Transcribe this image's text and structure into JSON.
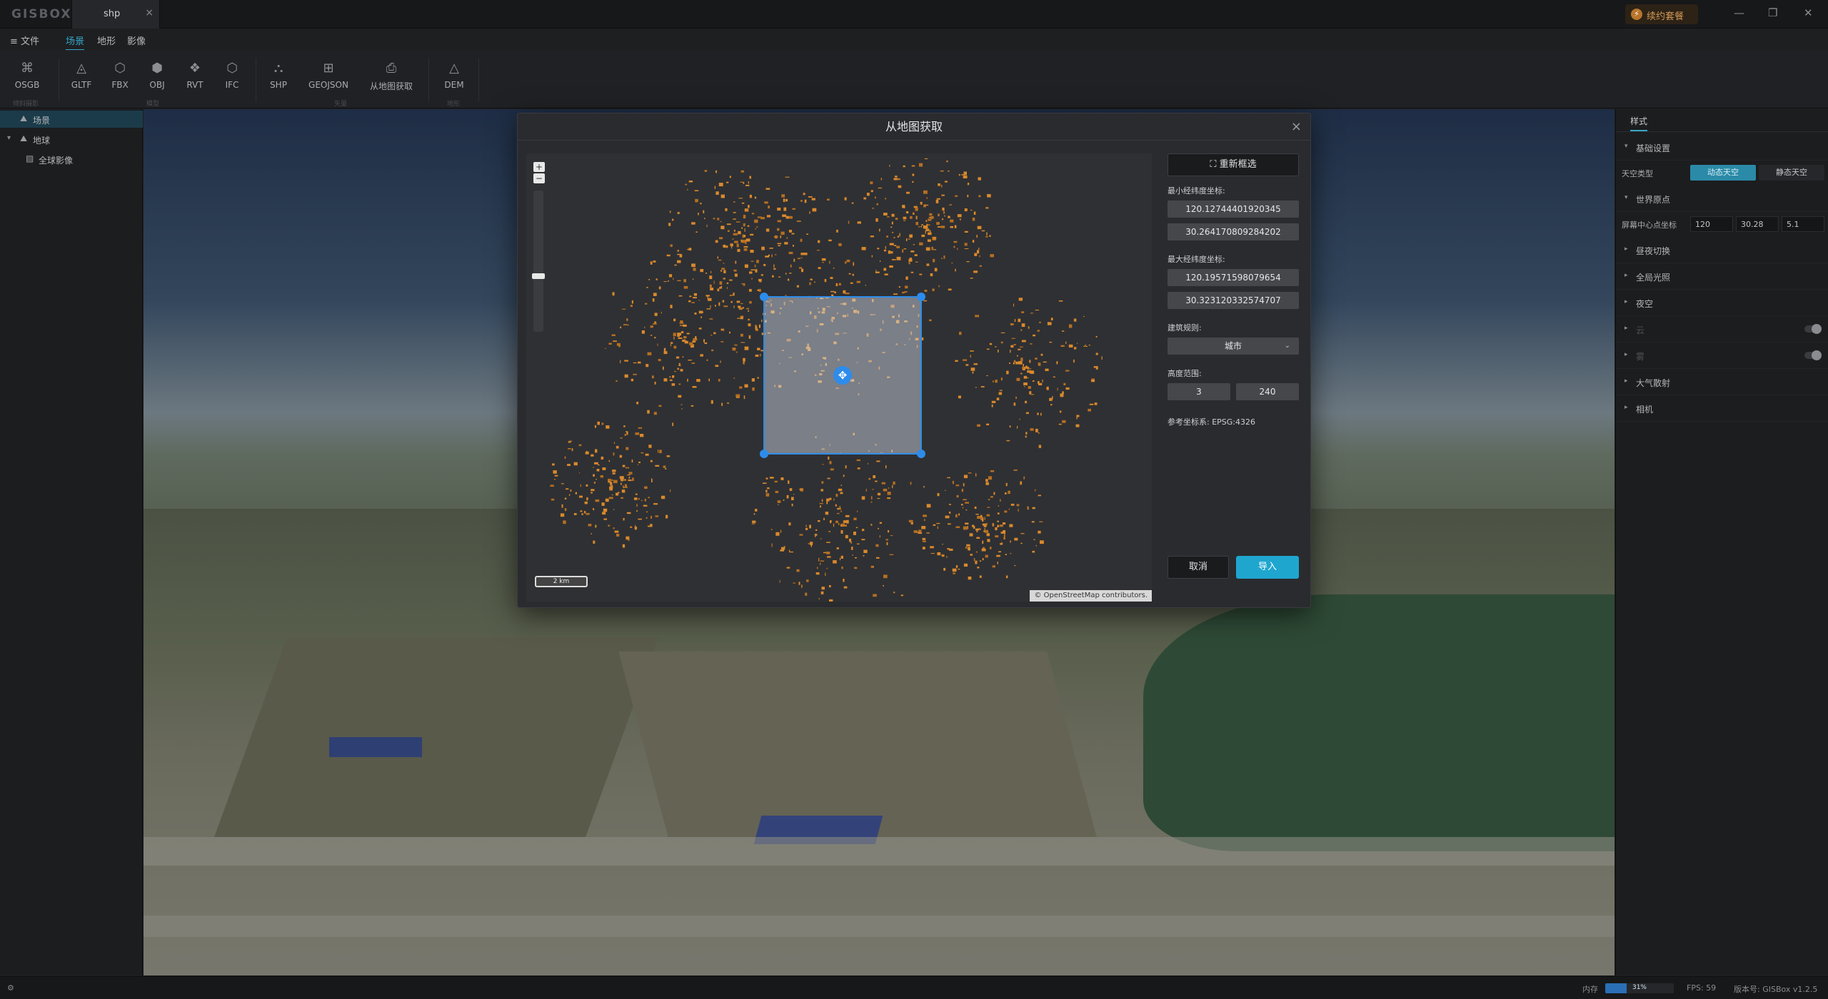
{
  "titlebar": {
    "logo": "GISBOX",
    "tab_label": "shp",
    "tab_close": "×",
    "renew_label": "续约套餐",
    "minimize": "—",
    "restore": "❐",
    "close": "✕"
  },
  "menubar": {
    "file": "≡ 文件",
    "items": [
      "场景",
      "地形",
      "影像"
    ],
    "active": "场景"
  },
  "toolbar": {
    "tools": [
      {
        "label": "OSGB",
        "icon": "osgb-icon"
      },
      {
        "label": "GLTF",
        "icon": "gltf-icon"
      },
      {
        "label": "FBX",
        "icon": "fbx-icon"
      },
      {
        "label": "OBJ",
        "icon": "obj-icon"
      },
      {
        "label": "RVT",
        "icon": "rvt-icon"
      },
      {
        "label": "IFC",
        "icon": "ifc-icon"
      },
      {
        "label": "SHP",
        "icon": "shp-icon"
      },
      {
        "label": "GEOJSON",
        "icon": "geojson-icon"
      },
      {
        "label": "从地图获取",
        "icon": "map-fetch-icon"
      },
      {
        "label": "DEM",
        "icon": "dem-icon"
      }
    ],
    "groups": [
      "倾斜摄影",
      "模型",
      "矢量",
      "地形"
    ]
  },
  "tree": {
    "items": [
      {
        "label": "场景",
        "selected": true
      },
      {
        "label": "地球",
        "selected": false
      },
      {
        "label": "全球影像",
        "selected": false
      }
    ]
  },
  "right_panel": {
    "tab": "样式",
    "sections": {
      "basic": "基础设置",
      "sky_type_label": "天空类型",
      "sky_dynamic": "动态天空",
      "sky_static": "静态天空",
      "world_origin": "世界原点",
      "screen_center_label": "屏幕中心点坐标",
      "center_lon": "120",
      "center_lat": "30.28",
      "center_h": "5.1",
      "day_night": "昼夜切换",
      "global_light": "全局光照",
      "night_sky": "夜空",
      "cloud": "云",
      "fog": "雾",
      "atmosphere": "大气散射",
      "camera": "相机"
    }
  },
  "status": {
    "settings_icon": "⚙",
    "memory_label": "内存",
    "memory_value": "31%",
    "memory_fraction": 0.31,
    "fps": "FPS: 59",
    "version": "版本号: GISBox v1.2.5"
  },
  "dialog": {
    "title": "从地图获取",
    "close": "×",
    "reselect": "重新框选",
    "min_label": "最小经纬度坐标:",
    "min_lon": "120.12744401920345",
    "min_lat": "30.264170809284202",
    "max_label": "最大经纬度坐标:",
    "max_lon": "120.19571598079654",
    "max_lat": "30.323120332574707",
    "rule_label": "建筑规则:",
    "rule_value": "城市",
    "height_label": "高度范围:",
    "height_min": "3",
    "height_max": "240",
    "crs_label": "参考坐标系: EPSG:4326",
    "cancel": "取消",
    "import": "导入",
    "map": {
      "zoom_in": "+",
      "zoom_out": "−",
      "scale": "2 km",
      "attribution": "© OpenStreetMap contributors.",
      "move_icon": "✥"
    }
  }
}
